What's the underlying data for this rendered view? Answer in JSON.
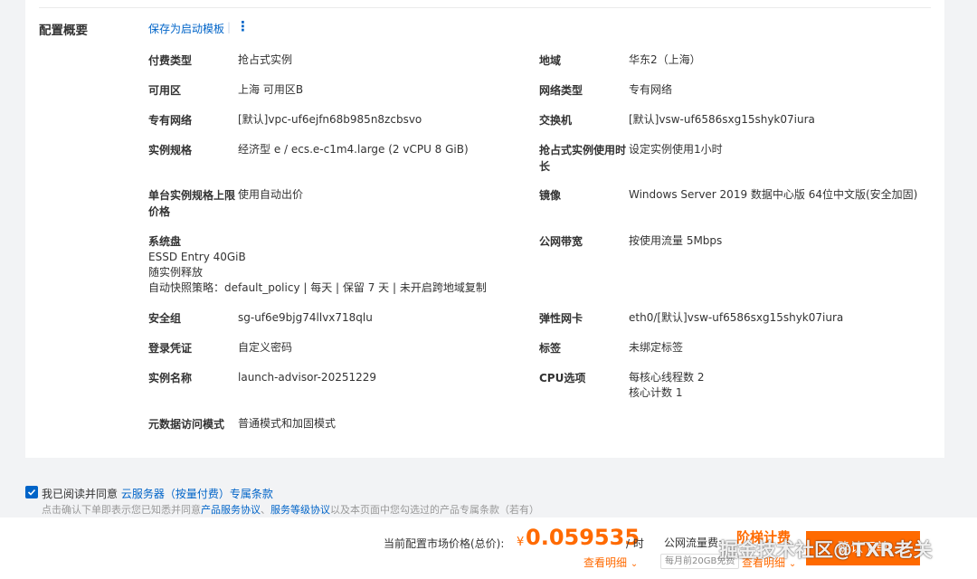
{
  "summary": {
    "title": "配置概要",
    "save_template": "保存为启动模板",
    "separator": "|",
    "more_icon": "⋮"
  },
  "fields_left": [
    {
      "label": "付费类型",
      "value": "抢占式实例"
    },
    {
      "label": "可用区",
      "value": "上海 可用区B"
    },
    {
      "label": "专有网络",
      "value": "[默认]vpc-uf6ejfn68b985n8zcbsvo"
    },
    {
      "label": "实例规格",
      "value": "经济型 e / ecs.e-c1m4.large (2 vCPU 8 GiB)"
    },
    {
      "label": "单台实例规格上限价格",
      "value": "使用自动出价"
    },
    {
      "label": "系统盘",
      "value_lines": [
        "ESSD Entry 40GiB",
        "随实例释放",
        "自动快照策略：default_policy | 每天 | 保留 7 天 | 未开启跨地域复制"
      ]
    },
    {
      "label": "安全组",
      "value": "sg-uf6e9bjg74llvx718qlu"
    },
    {
      "label": "登录凭证",
      "value": "自定义密码"
    },
    {
      "label": "实例名称",
      "value": "launch-advisor-20251229"
    },
    {
      "label": "元数据访问模式",
      "value": "普通模式和加固模式"
    }
  ],
  "fields_right": [
    {
      "label": "地域",
      "value": "华东2（上海）"
    },
    {
      "label": "网络类型",
      "value": "专有网络"
    },
    {
      "label": "交换机",
      "value": "[默认]vsw-uf6586sxg15shyk07iura"
    },
    {
      "label": "抢占式实例使用时长",
      "value": "设定实例使用1小时"
    },
    {
      "label": "镜像",
      "value": "Windows Server 2019 数据中心版 64位中文版(安全加固)"
    },
    {
      "label": "公网带宽",
      "value": "按使用流量 5Mbps"
    },
    {
      "label": "弹性网卡",
      "value": "eth0/[默认]vsw-uf6586sxg15shyk07iura"
    },
    {
      "label": "标签",
      "value": "未绑定标签"
    },
    {
      "label": "CPU选项",
      "value_lines": [
        "每核心线程数 2",
        "核心计数 1"
      ]
    }
  ],
  "agreement": {
    "checked": true,
    "prefix": "我已阅读并同意",
    "link1": "云服务器（按量付费）专属条款",
    "note_prefix": "点击确认下单即表示您已知悉并同意",
    "note_link1": "产品服务协议",
    "note_sep": "、",
    "note_link2": "服务等级协议",
    "note_suffix": "以及本页面中您勾选过的产品专属条款（若有）"
  },
  "footer": {
    "price_label": "当前配置市场价格(总价):",
    "currency": "¥",
    "price": "0.059535",
    "unit": "/ 时",
    "detail": "查看明细",
    "traffic_label": "公网流量费:",
    "traffic_value": "阶梯计费",
    "free_note": "每月前20GB免费",
    "detail2": "查看明细",
    "confirm": "确认下单",
    "watermark": "掘金技术社区@TXR老关"
  },
  "colors": {
    "accent": "#0064c8",
    "price": "#ff6a00",
    "button": "#ff6a00"
  }
}
